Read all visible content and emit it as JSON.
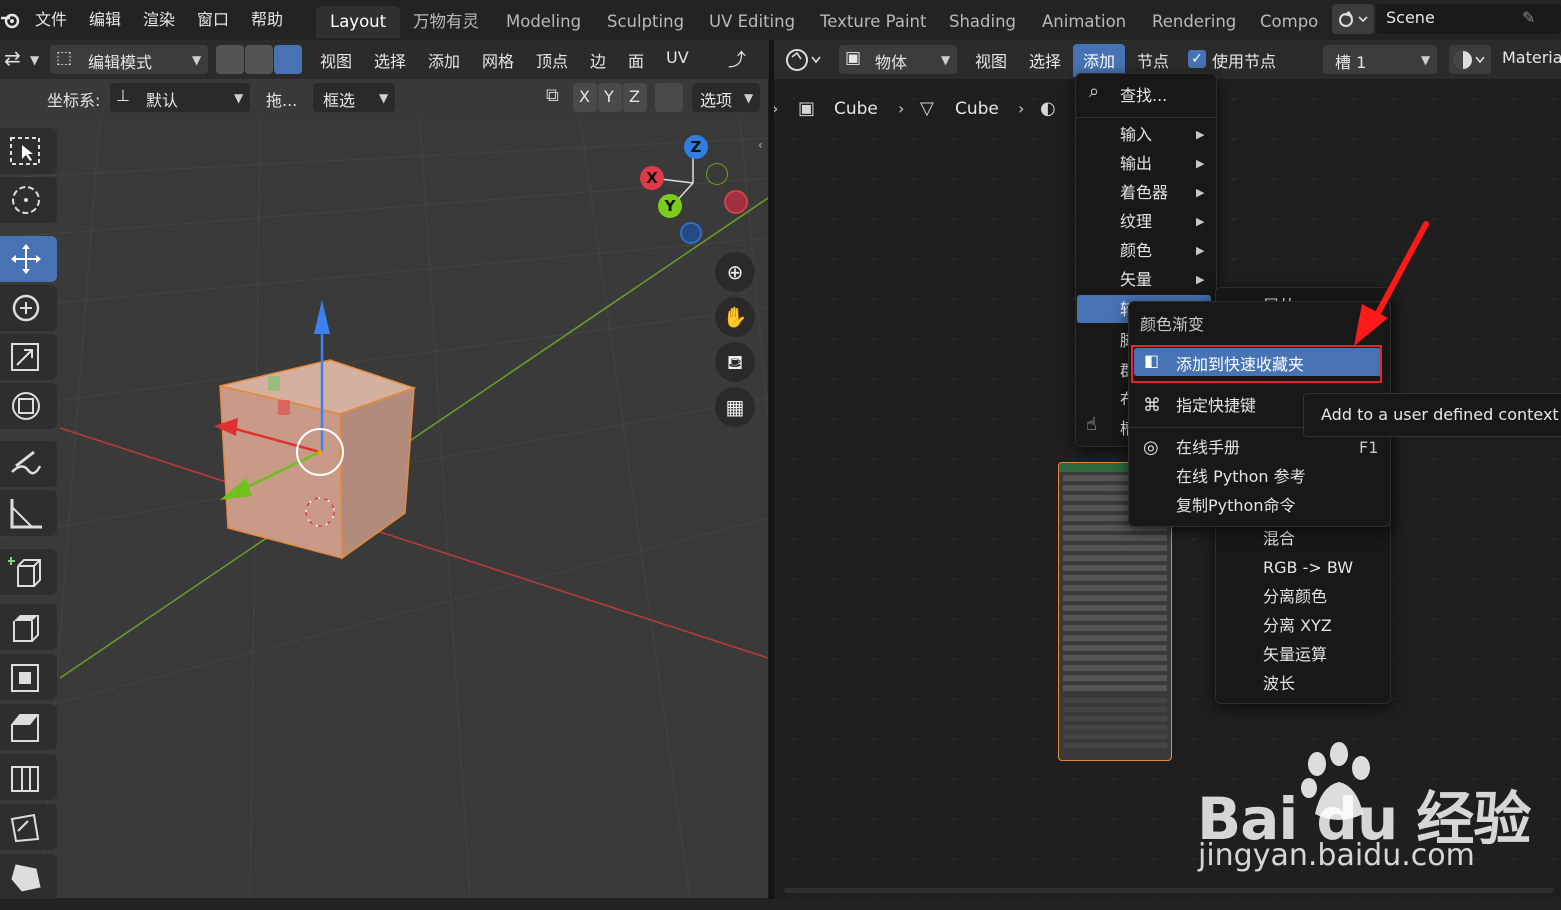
{
  "top_menu": [
    "文件",
    "编辑",
    "渲染",
    "窗口",
    "帮助"
  ],
  "workspaces": [
    "Layout",
    "万物有灵",
    "Modeling",
    "Sculpting",
    "UV Editing",
    "Texture Paint",
    "Shading",
    "Animation",
    "Rendering",
    "Compo"
  ],
  "scene_name": "Scene",
  "viewport_header": {
    "mode": "编辑模式",
    "menus": [
      "视图",
      "选择",
      "添加",
      "网格",
      "顶点",
      "边",
      "面",
      "UV"
    ],
    "coord_label": "坐标系:",
    "coord_value": "默认",
    "drag_label": "拖...",
    "select_box": "框选",
    "axis_x": "X",
    "axis_y": "Y",
    "axis_z": "Z",
    "options": "选项"
  },
  "gizmo": {
    "x": "X",
    "y": "Y",
    "z": "Z"
  },
  "node_header": {
    "object_mode": "物体",
    "menus": [
      "视图",
      "选择",
      "添加",
      "节点"
    ],
    "use_nodes": "使用节点",
    "slot": "槽 1",
    "material": "Materia"
  },
  "breadcrumb": [
    "Cube",
    "Cube"
  ],
  "add_menu": {
    "search": "查找...",
    "items": [
      "输入",
      "输出",
      "着色器",
      "纹理",
      "颜色",
      "矢量"
    ],
    "partial": [
      "转",
      "脚",
      "群",
      "布",
      "槽"
    ]
  },
  "context_menu": {
    "title": "颜色渐变",
    "add_fav": "添加到快速收藏夹",
    "shortcut": "指定快捷键",
    "manual": "在线手册",
    "manual_key": "F1",
    "python_ref": "在线 Python 参考",
    "copy_python": "复制Python命令"
  },
  "tooltip": "Add to a user defined context",
  "submenu": {
    "head": "屈从",
    "items": [
      "混合",
      "RGB -> BW",
      "分离颜色",
      "分离 XYZ",
      "矢量运算",
      "波长"
    ]
  },
  "watermark": {
    "brand": "Bai du 经验",
    "url": "jingyan.baidu.com"
  },
  "colors": {
    "accent": "#4772b3",
    "highlight_box": "#e0262f",
    "arrow": "#ff1a1a"
  }
}
